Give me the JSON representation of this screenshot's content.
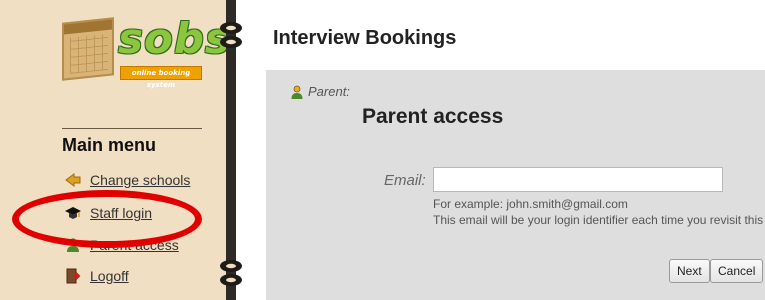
{
  "sidebar": {
    "logo": {
      "word": "sobs",
      "tagline": "online booking system"
    },
    "menu_title": "Main menu",
    "items": [
      {
        "label": "Change schools",
        "icon": "arrow-icon"
      },
      {
        "label": "Staff login",
        "icon": "graduation-cap-icon"
      },
      {
        "label": "Parent access",
        "icon": "user-icon"
      },
      {
        "label": "Logoff",
        "icon": "door-exit-icon"
      }
    ]
  },
  "main": {
    "title": "Interview Bookings",
    "panel": {
      "role_label": "Parent:",
      "heading": "Parent access",
      "email_label": "Email:",
      "email_value": "",
      "hint_example": "For example: john.smith@gmail.com",
      "hint_identifier": "This email will be your login identifier each time you revisit this site",
      "next_label": "Next",
      "cancel_label": "Cancel"
    }
  },
  "colors": {
    "sidebar_bg": "#f1dfc3",
    "panel_bg": "#dedede",
    "highlight": "#e10000",
    "logo_green": "#8cc63e"
  }
}
